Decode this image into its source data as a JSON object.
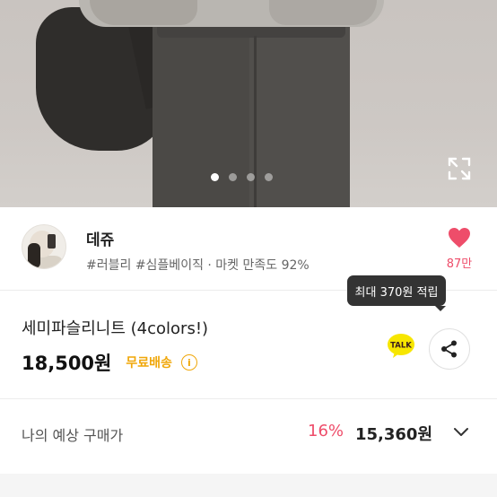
{
  "hero": {
    "slide_count": 4,
    "active_slide": 1,
    "expand_icon": "expand-icon"
  },
  "seller": {
    "name": "데쥬",
    "tags": "#러블리 #심플베이직 · 마켓 만족도 92%",
    "like_count": "87만",
    "heart_color": "#ee4d6a"
  },
  "tooltip": {
    "text": "최대 370원 적립"
  },
  "product": {
    "title": "세미파슬리니트 (4colors!)",
    "price": "18,500원",
    "shipping": "무료배송",
    "info_symbol": "i",
    "talk_label": "TALK"
  },
  "expected": {
    "label": "나의 예상 구매가",
    "discount": "16%",
    "price": "15,360원"
  },
  "colors": {
    "accent_pink": "#ee4d6a",
    "shipping_orange": "#f0a70a",
    "talk_yellow": "#f7e600"
  }
}
